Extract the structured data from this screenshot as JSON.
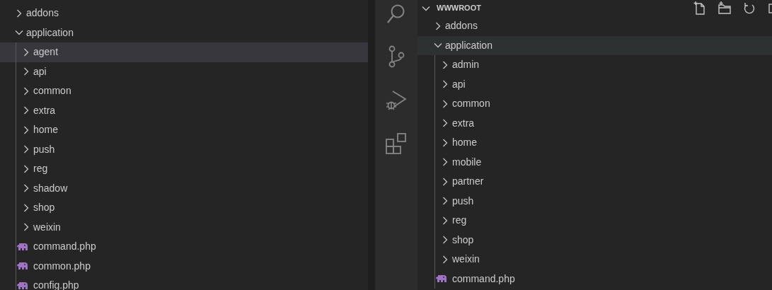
{
  "left_tree": [
    {
      "kind": "folder",
      "label": "addons",
      "expanded": false,
      "selected": false
    },
    {
      "kind": "folder",
      "label": "application",
      "expanded": true,
      "selected": false,
      "children": [
        {
          "kind": "folder",
          "label": "agent",
          "expanded": false,
          "selected": true
        },
        {
          "kind": "folder",
          "label": "api",
          "expanded": false,
          "selected": false
        },
        {
          "kind": "folder",
          "label": "common",
          "expanded": false,
          "selected": false
        },
        {
          "kind": "folder",
          "label": "extra",
          "expanded": false,
          "selected": false
        },
        {
          "kind": "folder",
          "label": "home",
          "expanded": false,
          "selected": false
        },
        {
          "kind": "folder",
          "label": "push",
          "expanded": false,
          "selected": false
        },
        {
          "kind": "folder",
          "label": "reg",
          "expanded": false,
          "selected": false
        },
        {
          "kind": "folder",
          "label": "shadow",
          "expanded": false,
          "selected": false
        },
        {
          "kind": "folder",
          "label": "shop",
          "expanded": false,
          "selected": false
        },
        {
          "kind": "folder",
          "label": "weixin",
          "expanded": false,
          "selected": false
        },
        {
          "kind": "file",
          "label": "command.php",
          "selected": false
        },
        {
          "kind": "file",
          "label": "common.php",
          "selected": false
        },
        {
          "kind": "file",
          "label": "config.php",
          "selected": false
        }
      ]
    }
  ],
  "activity_bar": [
    {
      "kind": "search"
    },
    {
      "kind": "source-control"
    },
    {
      "kind": "run-debug"
    },
    {
      "kind": "extensions"
    }
  ],
  "explorer": {
    "title": "WWWROOT",
    "expanded": true,
    "actions": [
      {
        "kind": "new-file"
      },
      {
        "kind": "new-folder"
      },
      {
        "kind": "refresh"
      },
      {
        "kind": "collapse"
      }
    ],
    "tree": [
      {
        "kind": "folder",
        "label": "addons",
        "expanded": false,
        "selected": false
      },
      {
        "kind": "folder",
        "label": "application",
        "expanded": true,
        "selected": false,
        "hovered": true,
        "children": [
          {
            "kind": "folder",
            "label": "admin",
            "expanded": false,
            "selected": false
          },
          {
            "kind": "folder",
            "label": "api",
            "expanded": false,
            "selected": false
          },
          {
            "kind": "folder",
            "label": "common",
            "expanded": false,
            "selected": false
          },
          {
            "kind": "folder",
            "label": "extra",
            "expanded": false,
            "selected": false
          },
          {
            "kind": "folder",
            "label": "home",
            "expanded": false,
            "selected": false
          },
          {
            "kind": "folder",
            "label": "mobile",
            "expanded": false,
            "selected": false
          },
          {
            "kind": "folder",
            "label": "partner",
            "expanded": false,
            "selected": false
          },
          {
            "kind": "folder",
            "label": "push",
            "expanded": false,
            "selected": false
          },
          {
            "kind": "folder",
            "label": "reg",
            "expanded": false,
            "selected": false
          },
          {
            "kind": "folder",
            "label": "shop",
            "expanded": false,
            "selected": false
          },
          {
            "kind": "folder",
            "label": "weixin",
            "expanded": false,
            "selected": false
          },
          {
            "kind": "file",
            "label": "command.php",
            "selected": false
          }
        ]
      }
    ]
  }
}
